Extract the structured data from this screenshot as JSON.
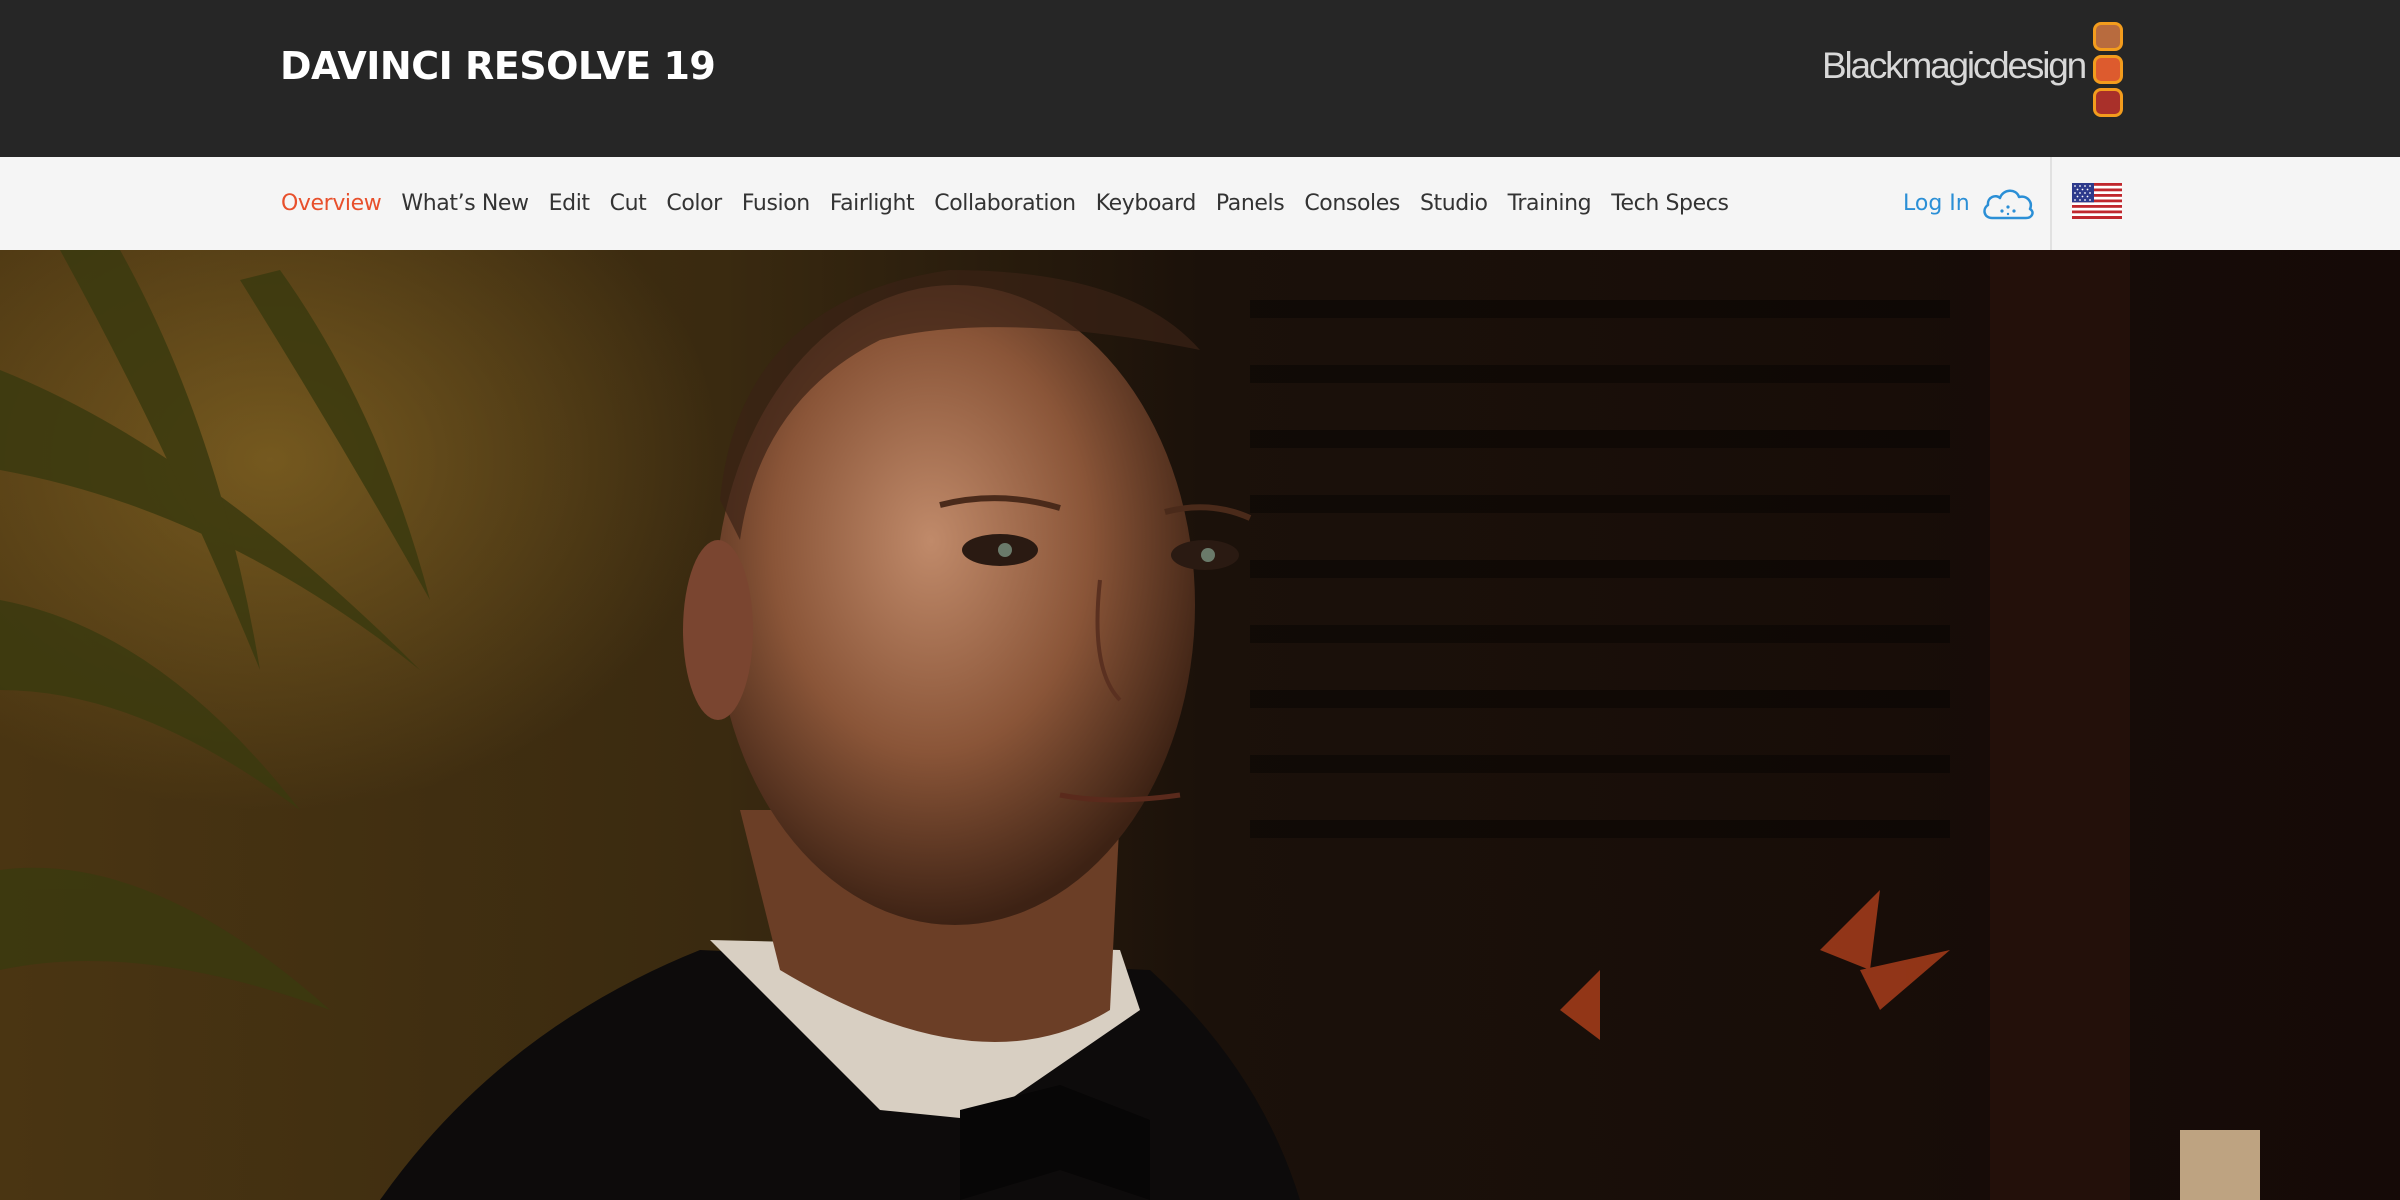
{
  "header": {
    "product_title": "DAVINCI RESOLVE 19",
    "brand_name": "Blackmagicdesign",
    "brand_colors": [
      "#b86b3e",
      "#dd5b2e",
      "#a9302a"
    ],
    "brand_border": "#f39c1d",
    "background": "#262626"
  },
  "nav": {
    "items": [
      {
        "label": "Overview",
        "active": true
      },
      {
        "label": "What’s New"
      },
      {
        "label": "Edit"
      },
      {
        "label": "Cut"
      },
      {
        "label": "Color"
      },
      {
        "label": "Fusion"
      },
      {
        "label": "Fairlight"
      },
      {
        "label": "Collaboration"
      },
      {
        "label": "Keyboard"
      },
      {
        "label": "Panels"
      },
      {
        "label": "Consoles"
      },
      {
        "label": "Studio"
      },
      {
        "label": "Training"
      },
      {
        "label": "Tech Specs"
      }
    ],
    "active_color": "#e8502c",
    "login_label": "Log In",
    "login_color": "#2b8fd6",
    "cloud_icon": "cloud-icon",
    "flag_icon": "us-flag-icon"
  },
  "hero": {
    "image_description_icon": "hero-photo"
  }
}
